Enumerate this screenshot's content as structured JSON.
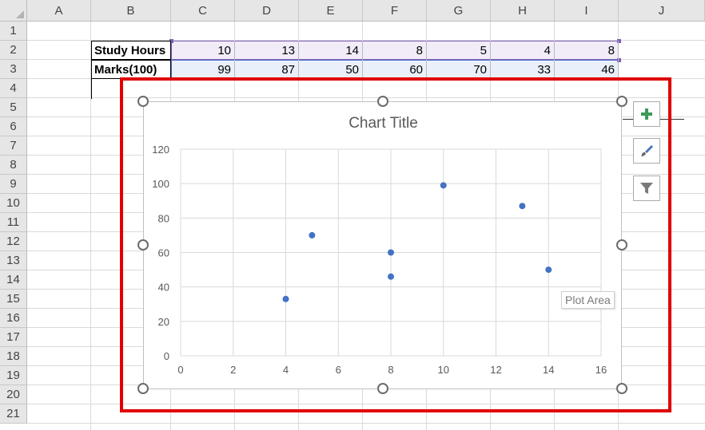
{
  "columns": [
    "A",
    "B",
    "C",
    "D",
    "E",
    "F",
    "G",
    "H",
    "I",
    "J"
  ],
  "rows": [
    "1",
    "2",
    "3",
    "4",
    "5",
    "6",
    "7",
    "8",
    "9",
    "10",
    "11",
    "12",
    "13",
    "14",
    "15",
    "16",
    "17",
    "18",
    "19",
    "20",
    "21"
  ],
  "table": {
    "hours_label": "Study Hours",
    "marks_label": "Marks(100)",
    "hours": [
      "10",
      "13",
      "14",
      "8",
      "5",
      "4",
      "8"
    ],
    "marks": [
      "99",
      "87",
      "50",
      "60",
      "70",
      "33",
      "46"
    ]
  },
  "chart_data": {
    "type": "scatter",
    "title": "Chart Title",
    "x": [
      10,
      13,
      14,
      8,
      5,
      4,
      8
    ],
    "y": [
      99,
      87,
      50,
      60,
      70,
      33,
      46
    ],
    "xlim": [
      0,
      16
    ],
    "ylim": [
      0,
      120
    ],
    "x_ticks": [
      "0",
      "2",
      "4",
      "6",
      "8",
      "10",
      "12",
      "14",
      "16"
    ],
    "y_ticks": [
      "0",
      "20",
      "40",
      "60",
      "80",
      "100",
      "120"
    ],
    "grid": true,
    "marker_color": "#4472c4"
  },
  "chart_ui": {
    "tooltip": "Plot Area",
    "buttons": [
      "chart-elements",
      "chart-styles",
      "chart-filters"
    ]
  },
  "colors": {
    "highlight": "#e00000",
    "series": "#4472c4"
  }
}
